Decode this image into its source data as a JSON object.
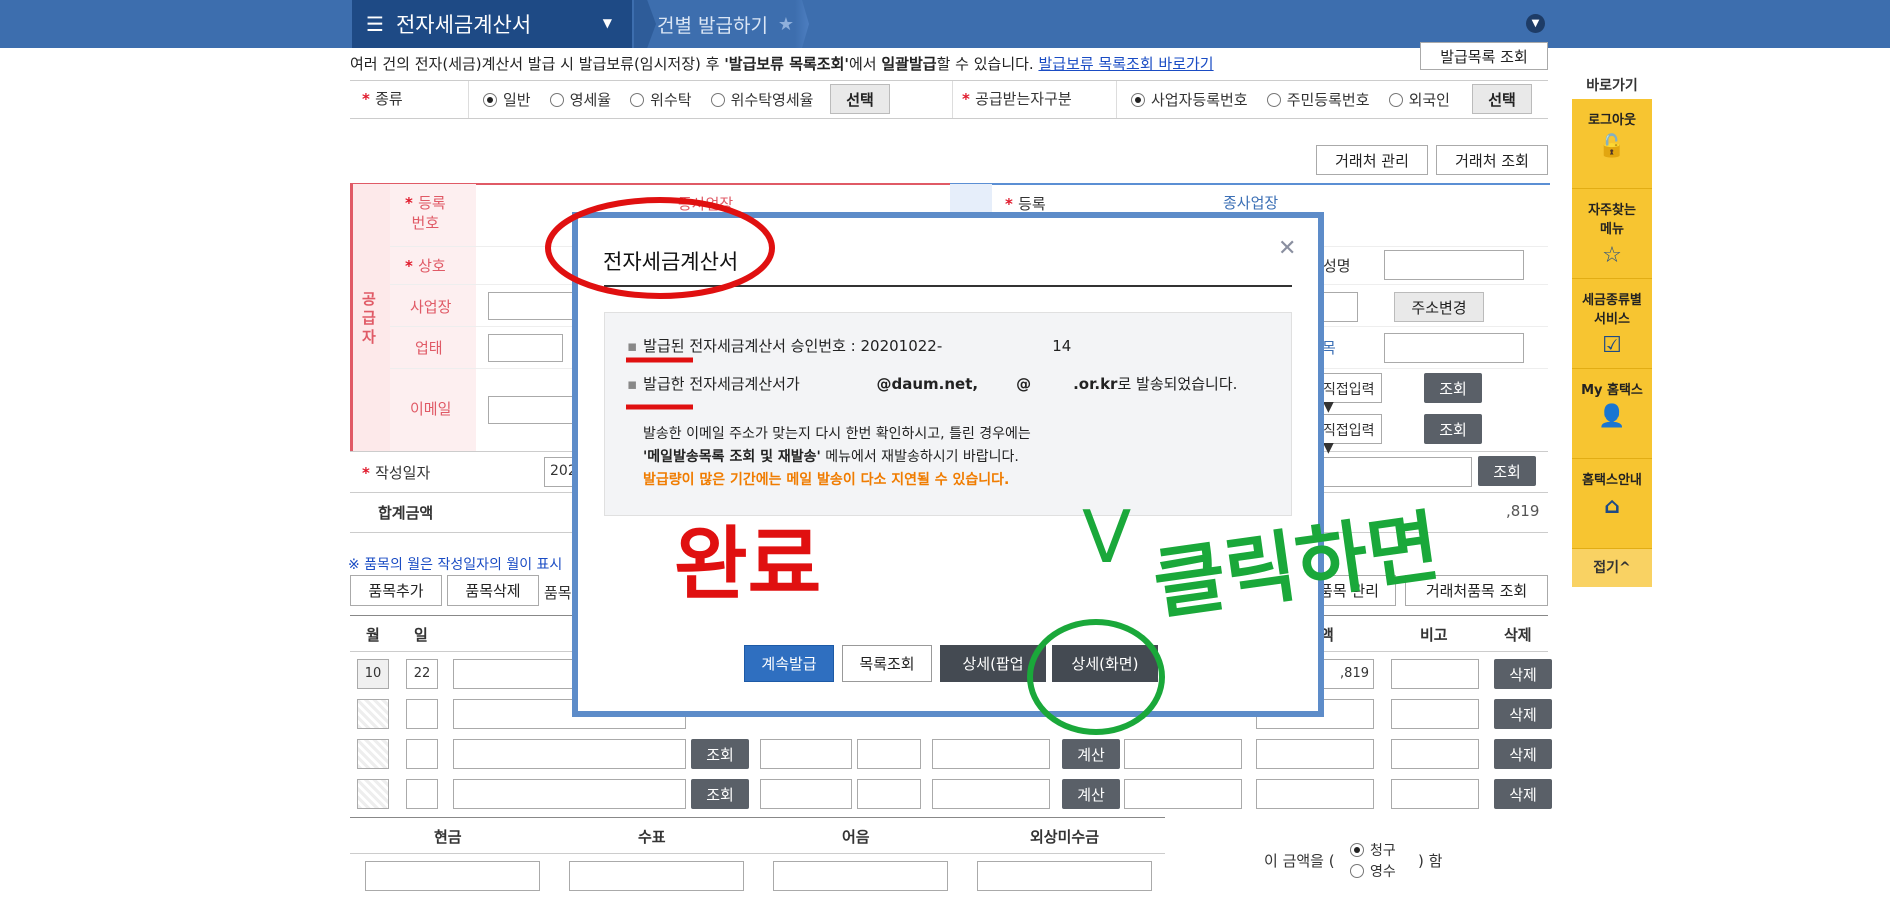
{
  "topbar": {
    "menu_title": "전자세금계산서",
    "breadcrumb": "건별 발급하기"
  },
  "notice": {
    "text_pre": "여러 건의 전자(세금)계산서 발급 시 발급보류(임시저장) 후 ",
    "text_bold1": "'발급보류 목록조회'",
    "text_mid": "에서 ",
    "text_bold2": "일괄발급",
    "text_post": "할 수 있습니다.",
    "link": "발급보류 목록조회 바로가기",
    "list_button": "발급목록 조회"
  },
  "type_row": {
    "label": "종류",
    "options": [
      "일반",
      "영세율",
      "위수탁",
      "위수탁영세율"
    ],
    "selected": "일반",
    "select_button": "선택",
    "recipient_label": "공급받는자구분",
    "recipient_options": [
      "사업자등록번호",
      "주민등록번호",
      "외국인"
    ],
    "recipient_selected": "사업자등록번호",
    "recipient_button": "선택"
  },
  "partner_buttons": {
    "manage": "거래처 관리",
    "lookup": "거래처 조회"
  },
  "supplier": {
    "side_label": "공급자",
    "reg_no": "등록\n번호",
    "sub_label": "종사업장",
    "name": "상호",
    "address": "사업장",
    "business": "업태",
    "email": "이메일"
  },
  "buyer": {
    "reg_no": "등록",
    "sub_label": "종사업장\n번호",
    "name_label": "성명",
    "address_button": "주소변경",
    "item_label": "목",
    "email_select": "직접입력",
    "lookup": "조회"
  },
  "date_row": {
    "label": "작성일자",
    "value": "202",
    "lookup": "조회"
  },
  "total_row": {
    "label": "합계금액",
    "value": ",819"
  },
  "items": {
    "note": "※ 품목의 월은 작성일자의 월이 표시",
    "add": "품목추가",
    "delete": "품목삭제",
    "tail": "품목",
    "item_manage": "품목 관리",
    "partner_item_lookup": "거래처품목 조회",
    "headers": {
      "month": "월",
      "day": "일",
      "remark": "비고",
      "del": "삭제",
      "price": "액"
    },
    "rows": [
      {
        "month": "10",
        "day": "22",
        "amount": ",819"
      },
      {
        "month": "",
        "day": "",
        "amount": ""
      },
      {
        "month": "",
        "day": "",
        "amount": ""
      },
      {
        "month": "",
        "day": "",
        "amount": ""
      }
    ],
    "lookup": "조회",
    "calc": "계산",
    "row_delete": "삭제"
  },
  "payment": {
    "cash": "현금",
    "check": "수표",
    "note": "어음",
    "credit": "외상미수금",
    "amount_pre": "이 금액을 (",
    "claim": "청구",
    "receipt": "영수",
    "amount_post": ") 함"
  },
  "sidebar": {
    "title": "바로가기",
    "items": [
      "로그아웃",
      "자주찾는\n메뉴",
      "세금종류별\n서비스",
      "My 홈택스",
      "홈택스안내"
    ],
    "close": "접기^"
  },
  "modal": {
    "title": "전자세금계산서",
    "line1_pre": "발급된 전자세금계산서 승인번호 : ",
    "line1_value": "20201022-",
    "line1_tail": "14",
    "line2_pre": "발급한 전자세금계산서가 ",
    "line2_email": "@daum.net,",
    "line2_email2": "@",
    "line2_email3": ".or.kr",
    "line2_post": "로 발송되었습니다.",
    "line3": "발송한 이메일 주소가 맞는지 다시 한번 확인하시고, 틀린 경우에는",
    "line4_bold": "'메일발송목록 조회 및 재발송'",
    "line4_post": " 메뉴에서 재발송하시기 바랍니다.",
    "line5_warn": "발급량이 많은 기간에는 메일 발송이 다소 지연될 수 있습니다.",
    "buttons": {
      "continue": "계속발급",
      "list": "목록조회",
      "detail_popup": "상세(팝업",
      "detail_screen": "상세(화면)"
    }
  },
  "annotations": {
    "done": "완료",
    "click": "클릭하면",
    "check": "V",
    "red": "#e01010",
    "green": "#1aa83a"
  }
}
